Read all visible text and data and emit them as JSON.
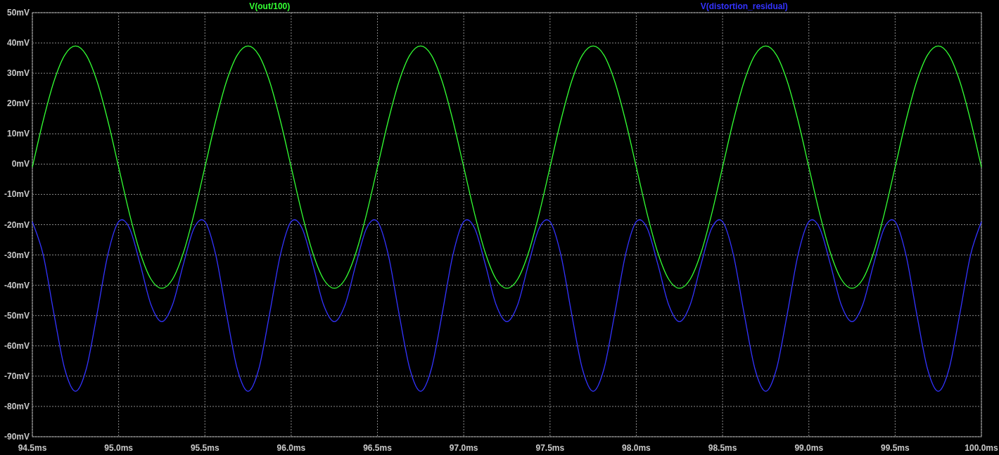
{
  "plot": {
    "chart_data": {
      "type": "line",
      "x": [
        94.5,
        94.5625,
        94.625,
        94.6875,
        94.75,
        94.8125,
        94.875,
        94.9375,
        95,
        95.0625,
        95.125,
        95.1875,
        95.25,
        95.3125,
        95.375,
        95.4375,
        95.5,
        95.5625,
        95.625,
        95.6875,
        95.75,
        95.8125,
        95.875,
        95.9375,
        96,
        96.0625,
        96.125,
        96.1875,
        96.25,
        96.3125,
        96.375,
        96.4375,
        96.5,
        96.5625,
        96.625,
        96.6875,
        96.75,
        96.8125,
        96.875,
        96.9375,
        97,
        97.0625,
        97.125,
        97.1875,
        97.25,
        97.3125,
        97.375,
        97.4375,
        97.5,
        97.5625,
        97.625,
        97.6875,
        97.75,
        97.8125,
        97.875,
        97.9375,
        98,
        98.0625,
        98.125,
        98.1875,
        98.25,
        98.3125,
        98.375,
        98.4375,
        98.5,
        98.5625,
        98.625,
        98.6875,
        98.75,
        98.8125,
        98.875,
        98.9375,
        99,
        99.0625,
        99.125,
        99.1875,
        99.25,
        99.3125,
        99.375,
        99.4375,
        99.5,
        99.5625,
        99.625,
        99.6875,
        99.75,
        99.8125,
        99.875,
        99.9375,
        100
      ],
      "series": [
        {
          "name": "V(out/100)",
          "color": "#33ff33",
          "values": [
            -1,
            14.3,
            27.3,
            36,
            39,
            36,
            27.3,
            14.3,
            -1,
            -16.3,
            -29.3,
            -38,
            -41,
            -38,
            -29.3,
            -16.3,
            -1,
            14.3,
            27.3,
            36,
            39,
            36,
            27.3,
            14.3,
            -1,
            -16.3,
            -29.3,
            -38,
            -41,
            -38,
            -29.3,
            -16.3,
            -1,
            14.3,
            27.3,
            36,
            39,
            36,
            27.3,
            14.3,
            -1,
            -16.3,
            -29.3,
            -38,
            -41,
            -38,
            -29.3,
            -16.3,
            -1,
            14.3,
            27.3,
            36,
            39,
            36,
            27.3,
            14.3,
            -1,
            -16.3,
            -29.3,
            -38,
            -41,
            -38,
            -29.3,
            -16.3,
            -1,
            14.3,
            27.3,
            36,
            39,
            36,
            27.3,
            14.3,
            -1,
            -16.3,
            -29.3,
            -38,
            -41,
            -38,
            -29.3,
            -16.3,
            -1,
            14.3,
            27.3,
            36,
            39,
            36,
            27.3,
            14.3,
            -1
          ]
        },
        {
          "name": "V(distortion_residual)",
          "color": "#3333ff",
          "values": [
            -19,
            -29.9,
            -49.4,
            -67.6,
            -75,
            -67.6,
            -49.4,
            -29.9,
            -19,
            -21.1,
            -33.1,
            -46.4,
            -52,
            -46.4,
            -33.1,
            -21.1,
            -19,
            -29.9,
            -49.4,
            -67.6,
            -75,
            -67.6,
            -49.4,
            -29.9,
            -19,
            -21.1,
            -33.1,
            -46.4,
            -52,
            -46.4,
            -33.1,
            -21.1,
            -19,
            -29.9,
            -49.4,
            -67.6,
            -75,
            -67.6,
            -49.4,
            -29.9,
            -19,
            -21.1,
            -33.1,
            -46.4,
            -52,
            -46.4,
            -33.1,
            -21.1,
            -19,
            -29.9,
            -49.4,
            -67.6,
            -75,
            -67.6,
            -49.4,
            -29.9,
            -19,
            -21.1,
            -33.1,
            -46.4,
            -52,
            -46.4,
            -33.1,
            -21.1,
            -19,
            -29.9,
            -49.4,
            -67.6,
            -75,
            -67.6,
            -49.4,
            -29.9,
            -19,
            -21.1,
            -33.1,
            -46.4,
            -52,
            -46.4,
            -33.1,
            -21.1,
            -19,
            -29.9,
            -49.4,
            -67.6,
            -75,
            -67.6,
            -49.4,
            -29.9,
            -19
          ]
        }
      ],
      "xlim": [
        94.5,
        100
      ],
      "ylim": [
        -90,
        50
      ],
      "grid": true,
      "xticks": [
        {
          "value": 94.5,
          "label": "94.5ms"
        },
        {
          "value": 95,
          "label": "95.0ms"
        },
        {
          "value": 95.5,
          "label": "95.5ms"
        },
        {
          "value": 96,
          "label": "96.0ms"
        },
        {
          "value": 96.5,
          "label": "96.5ms"
        },
        {
          "value": 97,
          "label": "97.0ms"
        },
        {
          "value": 97.5,
          "label": "97.5ms"
        },
        {
          "value": 98,
          "label": "98.0ms"
        },
        {
          "value": 98.5,
          "label": "98.5ms"
        },
        {
          "value": 99,
          "label": "99.0ms"
        },
        {
          "value": 99.5,
          "label": "99.5ms"
        },
        {
          "value": 100,
          "label": "100.0ms"
        }
      ],
      "yticks": [
        {
          "value": 50,
          "label": "50mV"
        },
        {
          "value": 40,
          "label": "40mV"
        },
        {
          "value": 30,
          "label": "30mV"
        },
        {
          "value": 20,
          "label": "20mV"
        },
        {
          "value": 10,
          "label": "10mV"
        },
        {
          "value": 0,
          "label": "0mV"
        },
        {
          "value": -10,
          "label": "-10mV"
        },
        {
          "value": -20,
          "label": "-20mV"
        },
        {
          "value": -30,
          "label": "-30mV"
        },
        {
          "value": -40,
          "label": "-40mV"
        },
        {
          "value": -50,
          "label": "-50mV"
        },
        {
          "value": -60,
          "label": "-60mV"
        },
        {
          "value": -70,
          "label": "-70mV"
        },
        {
          "value": -80,
          "label": "-80mV"
        },
        {
          "value": -90,
          "label": "-90mV"
        }
      ]
    }
  }
}
